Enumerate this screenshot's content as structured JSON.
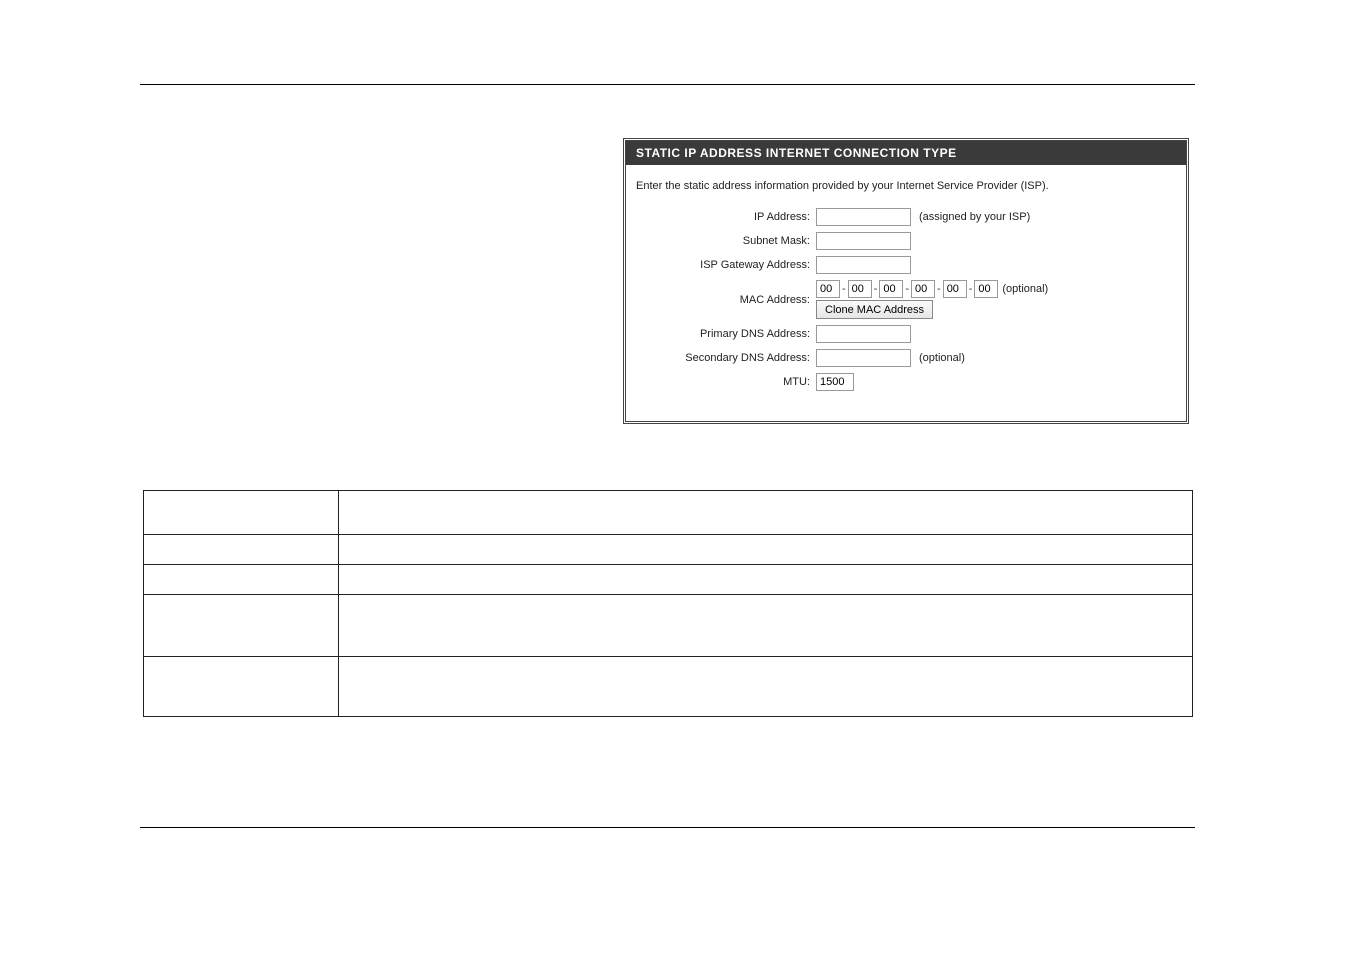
{
  "panel": {
    "title": "STATIC IP ADDRESS INTERNET CONNECTION TYPE",
    "description": "Enter the static address information provided by your Internet Service Provider (ISP).",
    "fields": {
      "ip_address": {
        "label": "IP Address:",
        "value": "",
        "hint": "(assigned by your ISP)"
      },
      "subnet_mask": {
        "label": "Subnet Mask:",
        "value": ""
      },
      "isp_gateway": {
        "label": "ISP Gateway Address:",
        "value": ""
      },
      "mac_address": {
        "label": "MAC Address:",
        "octets": [
          "00",
          "00",
          "00",
          "00",
          "00",
          "00"
        ],
        "hint": "(optional)",
        "clone_button": "Clone MAC Address"
      },
      "primary_dns": {
        "label": "Primary DNS Address:",
        "value": ""
      },
      "secondary_dns": {
        "label": "Secondary DNS Address:",
        "value": "",
        "hint": "(optional)"
      },
      "mtu": {
        "label": "MTU:",
        "value": "1500"
      }
    }
  },
  "separator": "-"
}
